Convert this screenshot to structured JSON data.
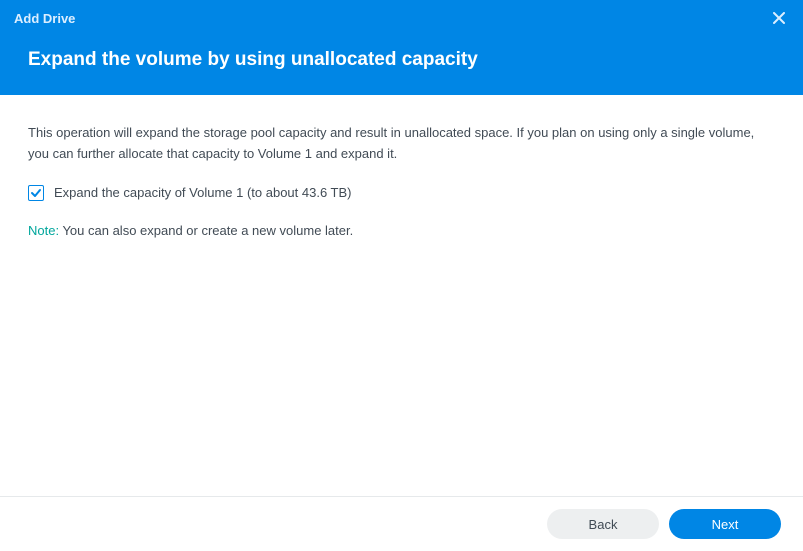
{
  "header": {
    "title": "Add Drive",
    "subtitle": "Expand the volume by using unallocated capacity"
  },
  "content": {
    "description": "This operation will expand the storage pool capacity and result in unallocated space. If you plan on using only a single volume, you can further allocate that capacity to Volume 1 and expand it.",
    "checkbox_label": "Expand the capacity of Volume 1 (to about 43.6 TB)",
    "note_label": "Note:",
    "note_text": " You can also expand or create a new volume later."
  },
  "footer": {
    "back_label": "Back",
    "next_label": "Next"
  }
}
